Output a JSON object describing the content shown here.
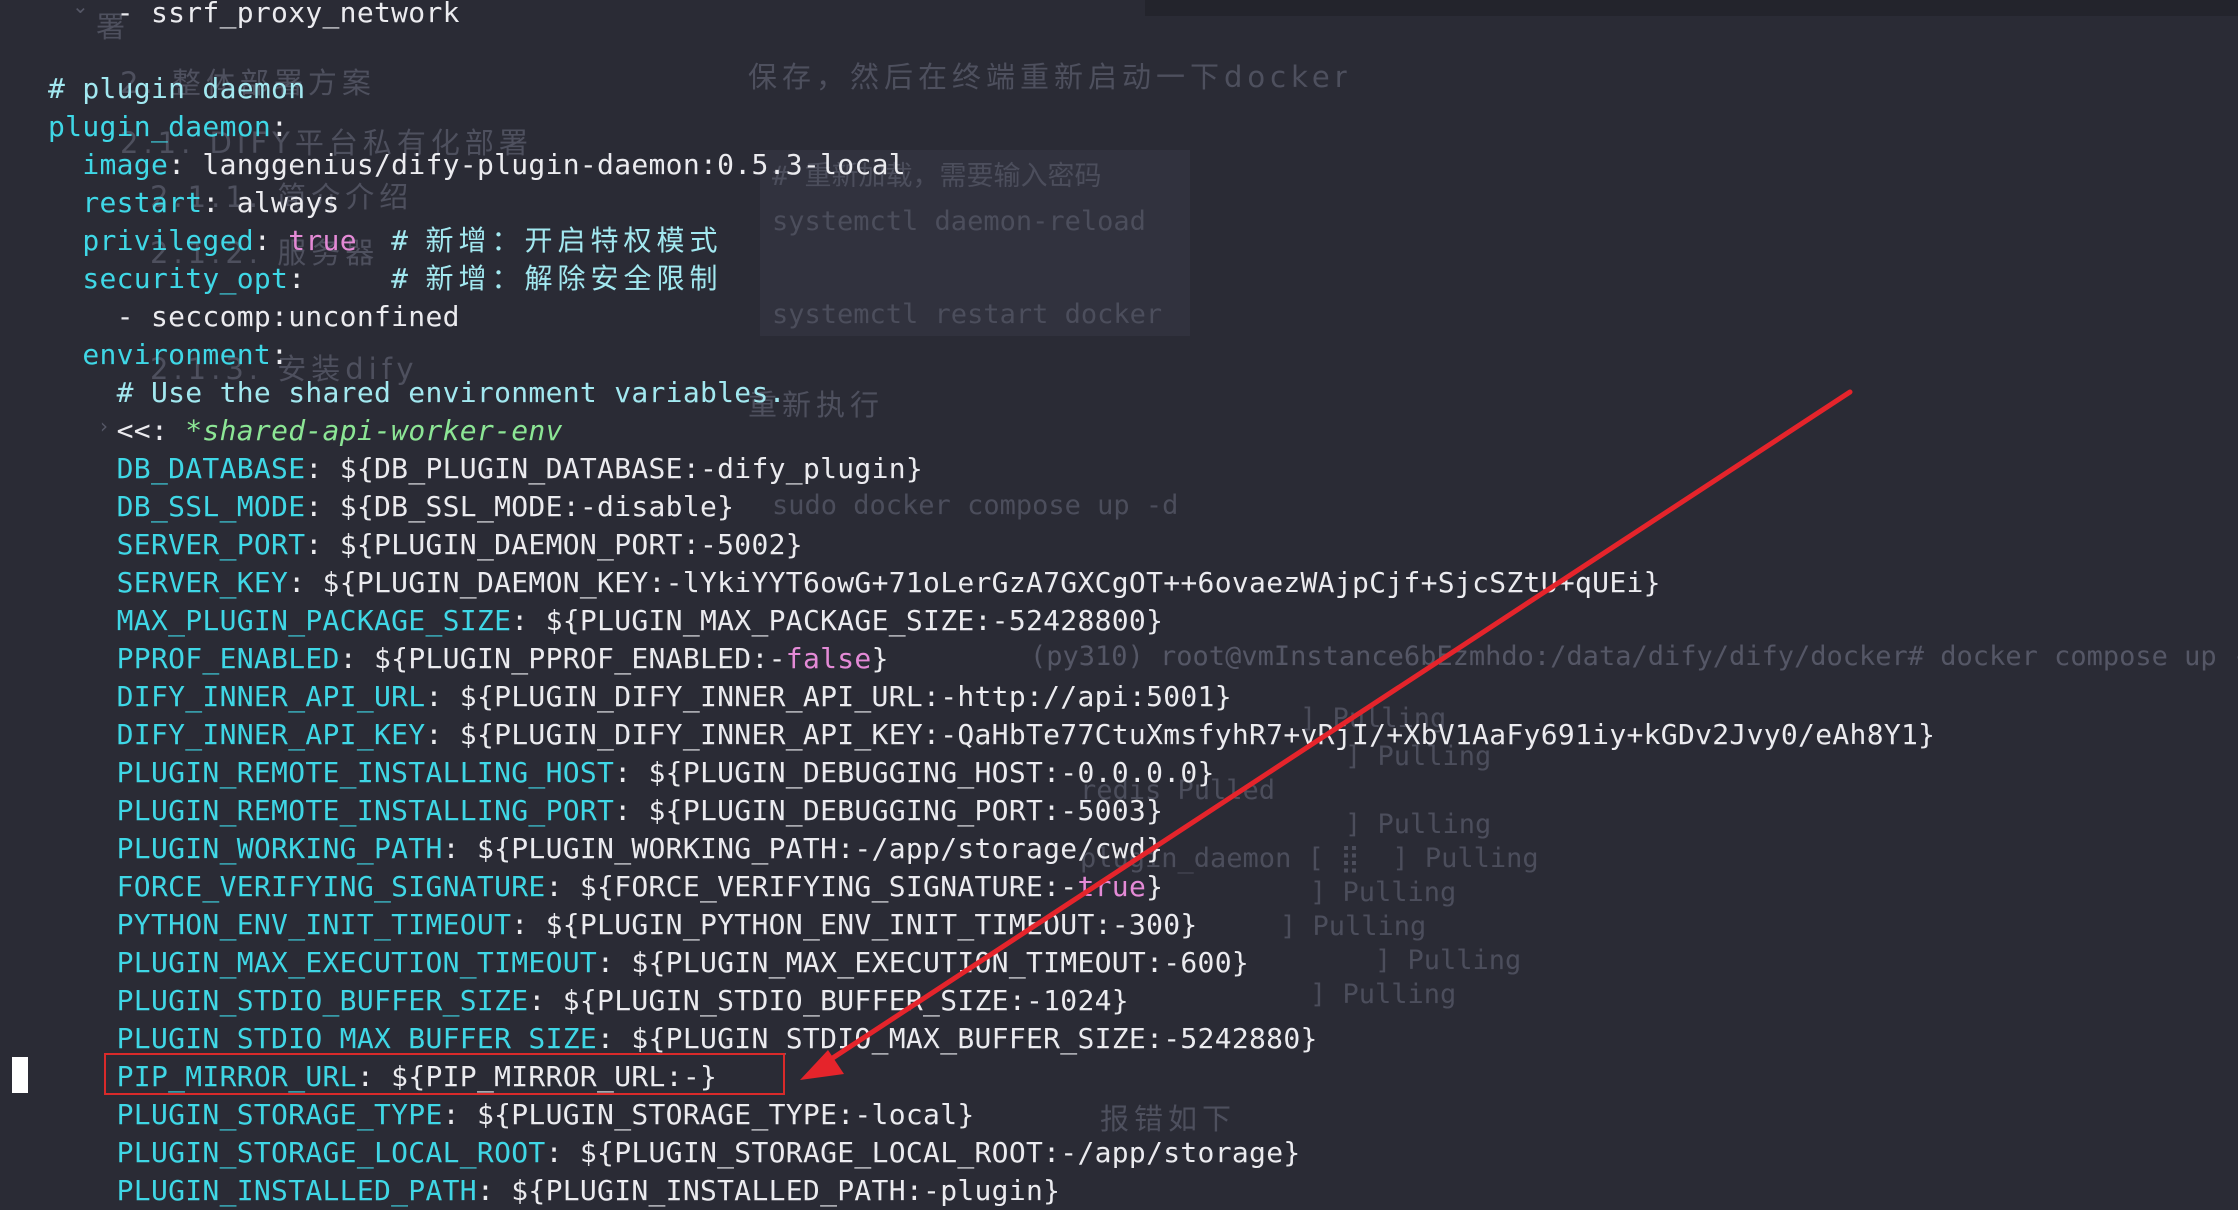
{
  "editor": {
    "lines": [
      [
        {
          "t": "    - ssrf_proxy_network",
          "c": "v"
        }
      ],
      [],
      [
        {
          "t": "# plugin daemon",
          "c": "c"
        }
      ],
      [
        {
          "t": "plugin_daemon",
          "c": "k"
        },
        {
          "t": ":",
          "c": "v"
        }
      ],
      [
        {
          "t": "  image",
          "c": "k"
        },
        {
          "t": ": langgenius/dify-plugin-daemon:0.5.3-local",
          "c": "v"
        }
      ],
      [
        {
          "t": "  restart",
          "c": "k"
        },
        {
          "t": ": always",
          "c": "v"
        }
      ],
      [
        {
          "t": "  privileged",
          "c": "k"
        },
        {
          "t": ": ",
          "c": "v"
        },
        {
          "t": "true",
          "c": "kw"
        },
        {
          "t": "  # ",
          "c": "c"
        },
        {
          "t": "新增：开启特权模式",
          "c": "c cjk"
        }
      ],
      [
        {
          "t": "  security_opt",
          "c": "k"
        },
        {
          "t": ":     ",
          "c": "v"
        },
        {
          "t": "# ",
          "c": "c"
        },
        {
          "t": "新增：解除安全限制",
          "c": "c cjk"
        }
      ],
      [
        {
          "t": "    - seccomp:unconfined",
          "c": "v"
        }
      ],
      [
        {
          "t": "  environment",
          "c": "k"
        },
        {
          "t": ":",
          "c": "v"
        }
      ],
      [
        {
          "t": "    # Use the shared environment variables.",
          "c": "c"
        }
      ],
      [
        {
          "t": "    <<",
          "c": "v"
        },
        {
          "t": ": ",
          "c": "v"
        },
        {
          "t": "*shared-api-worker-env",
          "c": "ref"
        }
      ],
      [
        {
          "t": "    DB_DATABASE",
          "c": "k"
        },
        {
          "t": ": ${DB_PLUGIN_DATABASE:-dify_plugin}",
          "c": "v"
        }
      ],
      [
        {
          "t": "    DB_SSL_MODE",
          "c": "k"
        },
        {
          "t": ": ${DB_SSL_MODE:-disable}",
          "c": "v"
        }
      ],
      [
        {
          "t": "    SERVER_PORT",
          "c": "k"
        },
        {
          "t": ": ${PLUGIN_DAEMON_PORT:-5002}",
          "c": "v"
        }
      ],
      [
        {
          "t": "    SERVER_KEY",
          "c": "k"
        },
        {
          "t": ": ${PLUGIN_DAEMON_KEY:-lYkiYYT6owG+71oLerGzA7GXCgOT++6ovaezWAjpCjf+SjcSZtU+qUEi}",
          "c": "v"
        }
      ],
      [
        {
          "t": "    MAX_PLUGIN_PACKAGE_SIZE",
          "c": "k"
        },
        {
          "t": ": ${PLUGIN_MAX_PACKAGE_SIZE:-52428800}",
          "c": "v"
        }
      ],
      [
        {
          "t": "    PPROF_ENABLED",
          "c": "k"
        },
        {
          "t": ": ${PLUGIN_PPROF_ENABLED:-",
          "c": "v"
        },
        {
          "t": "false",
          "c": "kw"
        },
        {
          "t": "}",
          "c": "v"
        }
      ],
      [
        {
          "t": "    DIFY_INNER_API_URL",
          "c": "k"
        },
        {
          "t": ": ${PLUGIN_DIFY_INNER_API_URL:-http://api:5001}",
          "c": "v"
        }
      ],
      [
        {
          "t": "    DIFY_INNER_API_KEY",
          "c": "k"
        },
        {
          "t": ": ${PLUGIN_DIFY_INNER_API_KEY:-QaHbTe77CtuXmsfyhR7+vRjI/+XbV1AaFy691iy+kGDv2Jvy0/eAh8Y1}",
          "c": "v"
        }
      ],
      [
        {
          "t": "    PLUGIN_REMOTE_INSTALLING_HOST",
          "c": "k"
        },
        {
          "t": ": ${PLUGIN_DEBUGGING_HOST:-0.0.0.0}",
          "c": "v"
        }
      ],
      [
        {
          "t": "    PLUGIN_REMOTE_INSTALLING_PORT",
          "c": "k"
        },
        {
          "t": ": ${PLUGIN_DEBUGGING_PORT:-5003}",
          "c": "v"
        }
      ],
      [
        {
          "t": "    PLUGIN_WORKING_PATH",
          "c": "k"
        },
        {
          "t": ": ${PLUGIN_WORKING_PATH:-/app/storage/cwd}",
          "c": "v"
        }
      ],
      [
        {
          "t": "    FORCE_VERIFYING_SIGNATURE",
          "c": "k"
        },
        {
          "t": ": ${FORCE_VERIFYING_SIGNATURE:-",
          "c": "v"
        },
        {
          "t": "true",
          "c": "kw"
        },
        {
          "t": "}",
          "c": "v"
        }
      ],
      [
        {
          "t": "    PYTHON_ENV_INIT_TIMEOUT",
          "c": "k"
        },
        {
          "t": ": ${PLUGIN_PYTHON_ENV_INIT_TIMEOUT:-300}",
          "c": "v"
        }
      ],
      [
        {
          "t": "    PLUGIN_MAX_EXECUTION_TIMEOUT",
          "c": "k"
        },
        {
          "t": ": ${PLUGIN_MAX_EXECUTION_TIMEOUT:-600}",
          "c": "v"
        }
      ],
      [
        {
          "t": "    PLUGIN_STDIO_BUFFER_SIZE",
          "c": "k"
        },
        {
          "t": ": ${PLUGIN_STDIO_BUFFER_SIZE:-1024}",
          "c": "v"
        }
      ],
      [
        {
          "t": "    PLUGIN_STDIO_MAX_BUFFER_SIZE",
          "c": "k"
        },
        {
          "t": ": ${PLUGIN_STDIO_MAX_BUFFER_SIZE:-5242880}",
          "c": "v"
        }
      ],
      [
        {
          "t": "    PIP_MIRROR_URL",
          "c": "k"
        },
        {
          "t": ": ${PIP_MIRROR_URL:-}",
          "c": "v"
        }
      ],
      [
        {
          "t": "    PLUGIN_STORAGE_TYPE",
          "c": "k"
        },
        {
          "t": ": ${PLUGIN_STORAGE_TYPE:-local}",
          "c": "v"
        }
      ],
      [
        {
          "t": "    PLUGIN_STORAGE_LOCAL_ROOT",
          "c": "k"
        },
        {
          "t": ": ${PLUGIN_STORAGE_LOCAL_ROOT:-/app/storage}",
          "c": "v"
        }
      ],
      [
        {
          "t": "    PLUGIN_INSTALLED_PATH",
          "c": "k"
        },
        {
          "t": ": ${PLUGIN_INSTALLED_PATH:-plugin}",
          "c": "v"
        }
      ]
    ]
  },
  "background": {
    "sidebar_items": [
      "署",
      "2. 整体部署方案",
      "2.1. DIFY平台私有化部署",
      "2.1.1. 简介介绍",
      "2.1.2. 服务器",
      "2.1.3. 安装dify"
    ],
    "doc_note": "保存，然后在终端重新启动一下docker",
    "cmd_comment": "# 重新加载，需要输入密码",
    "cmd_reload": "systemctl daemon-reload",
    "cmd_restart": "systemctl restart docker",
    "rerun_heading": "重新执行",
    "cmd_up": "sudo docker compose up -d",
    "terminal_prompt": "(py310) root@vmInstance6bEzmhdo:/data/dify/dify/docker# docker compose up -d",
    "pulling_lines": [
      "] Pulling",
      "] Pulling",
      "redis Pulled",
      "] Pulling",
      "plugin_daemon [ ⣿  ] Pulling",
      "] Pulling",
      "] Pulling",
      "] Pulling",
      "] Pulling"
    ],
    "error_heading": "报错如下"
  },
  "annotation": {
    "arrow_color": "#e5242b",
    "box_color": "#d92a2a"
  }
}
